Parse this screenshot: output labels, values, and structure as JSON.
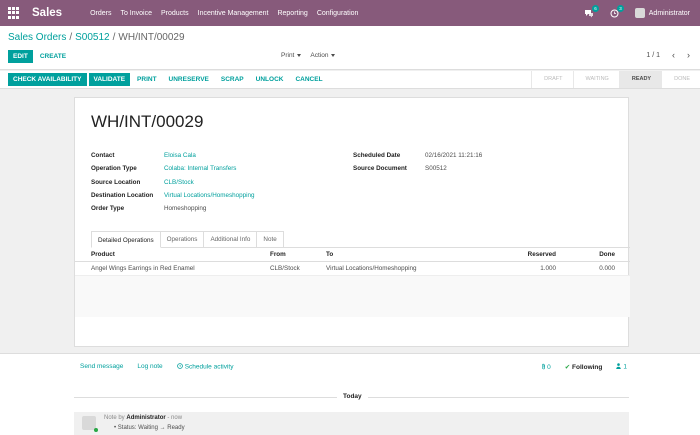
{
  "topbar": {
    "app_name": "Sales",
    "menu": [
      "Orders",
      "To Invoice",
      "Products",
      "Incentive Management",
      "Reporting",
      "Configuration"
    ],
    "messages_count": "6",
    "activities_count": "3",
    "user": "Administrator"
  },
  "breadcrumb": {
    "root": "Sales Orders",
    "parent": "S00512",
    "current": "WH/INT/00029"
  },
  "control": {
    "edit": "EDIT",
    "create": "CREATE",
    "print": "Print",
    "action": "Action",
    "pager": "1 / 1"
  },
  "statusbar": {
    "buttons": {
      "check_availability": "CHECK AVAILABILITY",
      "validate": "VALIDATE",
      "print": "PRINT",
      "unreserve": "UNRESERVE",
      "scrap": "SCRAP",
      "unlock": "UNLOCK",
      "cancel": "CANCEL"
    },
    "stages": {
      "draft": "DRAFT",
      "waiting": "WAITING",
      "ready": "READY",
      "done": "DONE"
    }
  },
  "record": {
    "name": "WH/INT/00029",
    "left": {
      "contact_label": "Contact",
      "contact": "Eloisa Cala",
      "operation_type_label": "Operation Type",
      "operation_type": "Colaba: Internal Transfers",
      "source_location_label": "Source Location",
      "source_location": "CLB/Stock",
      "destination_location_label": "Destination Location",
      "destination_location": "Virtual Locations/Homeshopping",
      "order_type_label": "Order Type",
      "order_type": "Homeshopping"
    },
    "right": {
      "scheduled_date_label": "Scheduled Date",
      "scheduled_date": "02/16/2021 11:21:16",
      "source_document_label": "Source Document",
      "source_document": "S00512"
    },
    "tabs": {
      "detailed_operations": "Detailed Operations",
      "operations": "Operations",
      "additional_info": "Additional Info",
      "note": "Note"
    },
    "table": {
      "headers": {
        "product": "Product",
        "from": "From",
        "to": "To",
        "reserved": "Reserved",
        "done": "Done"
      },
      "rows": [
        {
          "product": "Angel Wings Earrings in Red Enamel",
          "from": "CLB/Stock",
          "to": "Virtual Locations/Homeshopping",
          "reserved": "1.000",
          "done": "0.000"
        }
      ]
    }
  },
  "chatter": {
    "send_message": "Send message",
    "log_note": "Log note",
    "schedule_activity": "Schedule activity",
    "attachments": "0",
    "following": "Following",
    "followers": "1",
    "today": "Today",
    "message": {
      "prefix": "Note by",
      "author": "Administrator",
      "time": "- now",
      "body": "Status: Waiting → Ready"
    }
  }
}
